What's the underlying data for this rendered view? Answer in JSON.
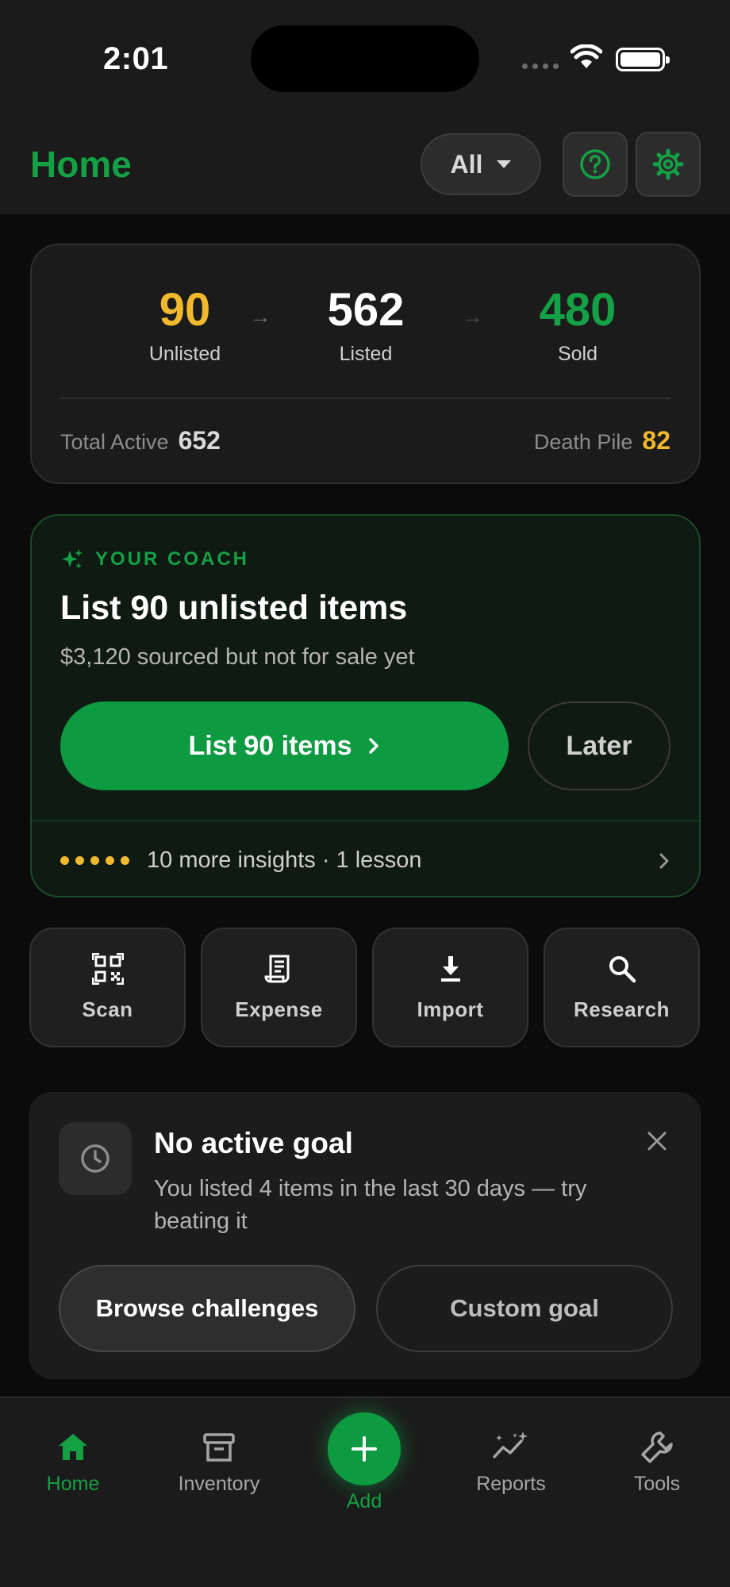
{
  "status_bar": {
    "time": "2:01"
  },
  "header": {
    "title": "Home",
    "filter_label": "All",
    "help_icon": "help-circle-icon",
    "settings_icon": "gear-icon"
  },
  "stats": {
    "unlisted": {
      "value": "90",
      "label": "Unlisted",
      "color": "#f0b92e"
    },
    "listed": {
      "value": "562",
      "label": "Listed",
      "color": "#ffffff"
    },
    "sold": {
      "value": "480",
      "label": "Sold",
      "color": "#14a045"
    },
    "total_active_label": "Total Active",
    "total_active_value": "652",
    "death_pile_label": "Death Pile",
    "death_pile_value": "82"
  },
  "coach": {
    "eyebrow": "YOUR COACH",
    "title": "List 90 unlisted items",
    "subtitle": "$3,120 sourced but not for sale yet",
    "primary_label": "List 90 items",
    "later_label": "Later",
    "insights_text": "10 more insights · 1 lesson"
  },
  "quick_actions": [
    {
      "label": "Scan",
      "icon": "qr-scan-icon"
    },
    {
      "label": "Expense",
      "icon": "receipt-icon"
    },
    {
      "label": "Import",
      "icon": "download-icon"
    },
    {
      "label": "Research",
      "icon": "search-icon"
    }
  ],
  "goal": {
    "title": "No active goal",
    "description": "You listed 4 items in the last 30 days — try beating it",
    "browse_label": "Browse challenges",
    "custom_label": "Custom goal"
  },
  "tabbar": {
    "home": "Home",
    "inventory": "Inventory",
    "add": "Add",
    "reports": "Reports",
    "tools": "Tools"
  },
  "colors": {
    "accent": "#14a045",
    "accent_button": "#0e9a41",
    "warning": "#f0b92e",
    "background": "#0b0b0b",
    "surface": "#1b1b1b"
  }
}
